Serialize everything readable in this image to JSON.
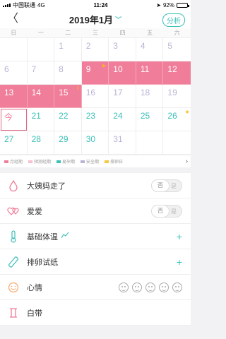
{
  "status": {
    "carrier": "中国联通",
    "network": "4G",
    "time": "11:24",
    "battery": "92%",
    "battery_level": 0.92
  },
  "header": {
    "title": "2019年1月",
    "analyze_label": "分析"
  },
  "weekdays": [
    "日",
    "一",
    "二",
    "三",
    "四",
    "五",
    "六"
  ],
  "days": [
    {
      "d": "",
      "s": "empty"
    },
    {
      "d": "",
      "s": "empty"
    },
    {
      "d": "1",
      "s": "gray"
    },
    {
      "d": "2",
      "s": "gray"
    },
    {
      "d": "3",
      "s": "gray"
    },
    {
      "d": "4",
      "s": "gray"
    },
    {
      "d": "5",
      "s": "gray"
    },
    {
      "d": "6",
      "s": "gray"
    },
    {
      "d": "7",
      "s": "gray"
    },
    {
      "d": "8",
      "s": "gray"
    },
    {
      "d": "9",
      "s": "period",
      "flag": "▶"
    },
    {
      "d": "10",
      "s": "period"
    },
    {
      "d": "11",
      "s": "period"
    },
    {
      "d": "12",
      "s": "period"
    },
    {
      "d": "13",
      "s": "period"
    },
    {
      "d": "14",
      "s": "period"
    },
    {
      "d": "15",
      "s": "period",
      "flag2": "II"
    },
    {
      "d": "16",
      "s": "gray"
    },
    {
      "d": "17",
      "s": "gray"
    },
    {
      "d": "18",
      "s": "gray"
    },
    {
      "d": "19",
      "s": "gray"
    },
    {
      "d": "今",
      "s": "today"
    },
    {
      "d": "21",
      "s": "teal"
    },
    {
      "d": "22",
      "s": "teal"
    },
    {
      "d": "23",
      "s": "teal"
    },
    {
      "d": "24",
      "s": "teal"
    },
    {
      "d": "25",
      "s": "teal"
    },
    {
      "d": "26",
      "s": "teal",
      "star": "✹"
    },
    {
      "d": "27",
      "s": "teal"
    },
    {
      "d": "28",
      "s": "teal"
    },
    {
      "d": "29",
      "s": "teal"
    },
    {
      "d": "30",
      "s": "teal"
    },
    {
      "d": "31",
      "s": "gray"
    },
    {
      "d": "",
      "s": "empty"
    },
    {
      "d": "",
      "s": "empty"
    }
  ],
  "legend": [
    {
      "label": "月经期",
      "color": "#f07d99"
    },
    {
      "label": "预测经期",
      "color": "#f7c1cf"
    },
    {
      "label": "易孕期",
      "color": "#3cc0b7"
    },
    {
      "label": "安全期",
      "color": "#b9b4d6"
    },
    {
      "label": "排卵日",
      "color": "#f5c842"
    }
  ],
  "rows": [
    {
      "label": "大姨妈走了",
      "icon": "drop-icon",
      "control": "toggle",
      "value": "否",
      "other": "是"
    },
    {
      "label": "爱爱",
      "icon": "hearts-icon",
      "control": "toggle",
      "value": "否",
      "other": "是"
    },
    {
      "label": "基础体温",
      "icon": "thermometer-icon",
      "control": "plus",
      "extra": "chart-icon"
    },
    {
      "label": "排卵试纸",
      "icon": "test-strip-icon",
      "control": "plus"
    },
    {
      "label": "心情",
      "icon": "smile-icon",
      "control": "moods"
    },
    {
      "label": "白带",
      "icon": "discharge-icon",
      "control": "none"
    }
  ],
  "colors": {
    "accent": "#3cc0b7",
    "period": "#f07d99",
    "safe": "#b9b4d6"
  }
}
